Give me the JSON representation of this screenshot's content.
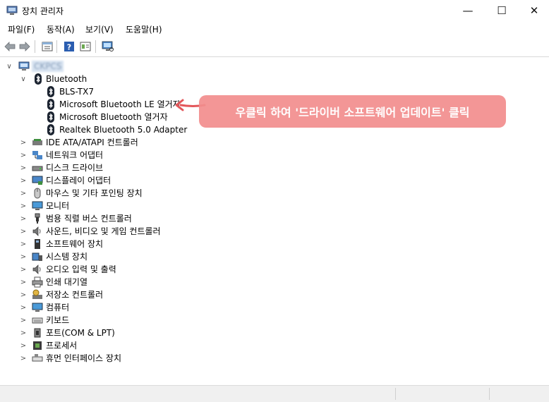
{
  "window": {
    "title": "장치 관리자",
    "minimize_glyph": "—",
    "maximize_glyph": "☐",
    "close_glyph": "✕"
  },
  "menu": [
    {
      "label": "파일(F)"
    },
    {
      "label": "동작(A)"
    },
    {
      "label": "보기(V)"
    },
    {
      "label": "도움말(H)"
    }
  ],
  "toolbar": {
    "icons": [
      "back-arrow-icon",
      "forward-arrow-icon",
      "properties-icon",
      "help-icon",
      "update-driver-icon",
      "scan-hardware-icon"
    ]
  },
  "tree": {
    "root": {
      "label": "CKPCS",
      "expanded": true
    },
    "bluetooth": {
      "label": "Bluetooth",
      "expanded": true,
      "children": [
        {
          "label": "BLS-TX7"
        },
        {
          "label": "Microsoft Bluetooth LE 열거자"
        },
        {
          "label": "Microsoft Bluetooth 열거자"
        },
        {
          "label": "Realtek Bluetooth 5.0 Adapter"
        }
      ]
    },
    "categories": [
      {
        "label": "IDE ATA/ATAPI 컨트롤러",
        "icon": "ide-controller-icon"
      },
      {
        "label": "네트워크 어댑터",
        "icon": "network-adapter-icon"
      },
      {
        "label": "디스크 드라이브",
        "icon": "disk-drive-icon"
      },
      {
        "label": "디스플레이 어댑터",
        "icon": "display-adapter-icon"
      },
      {
        "label": "마우스 및 기타 포인팅 장치",
        "icon": "mouse-icon"
      },
      {
        "label": "모니터",
        "icon": "monitor-icon"
      },
      {
        "label": "범용 직렬 버스 컨트롤러",
        "icon": "usb-icon"
      },
      {
        "label": "사운드, 비디오 및 게임 컨트롤러",
        "icon": "speaker-icon"
      },
      {
        "label": "소프트웨어 장치",
        "icon": "software-device-icon"
      },
      {
        "label": "시스템 장치",
        "icon": "system-device-icon"
      },
      {
        "label": "오디오 입력 및 출력",
        "icon": "audio-icon"
      },
      {
        "label": "인쇄 대기열",
        "icon": "printer-icon"
      },
      {
        "label": "저장소 컨트롤러",
        "icon": "storage-controller-icon"
      },
      {
        "label": "컴퓨터",
        "icon": "computer-icon"
      },
      {
        "label": "키보드",
        "icon": "keyboard-icon"
      },
      {
        "label": "포트(COM & LPT)",
        "icon": "port-icon"
      },
      {
        "label": "프로세서",
        "icon": "processor-icon"
      },
      {
        "label": "휴먼 인터페이스 장치",
        "icon": "hid-icon"
      }
    ]
  },
  "annotation": {
    "text": "우클릭 하여 '드라이버 소프트웨어 업데이트' 클릭"
  }
}
